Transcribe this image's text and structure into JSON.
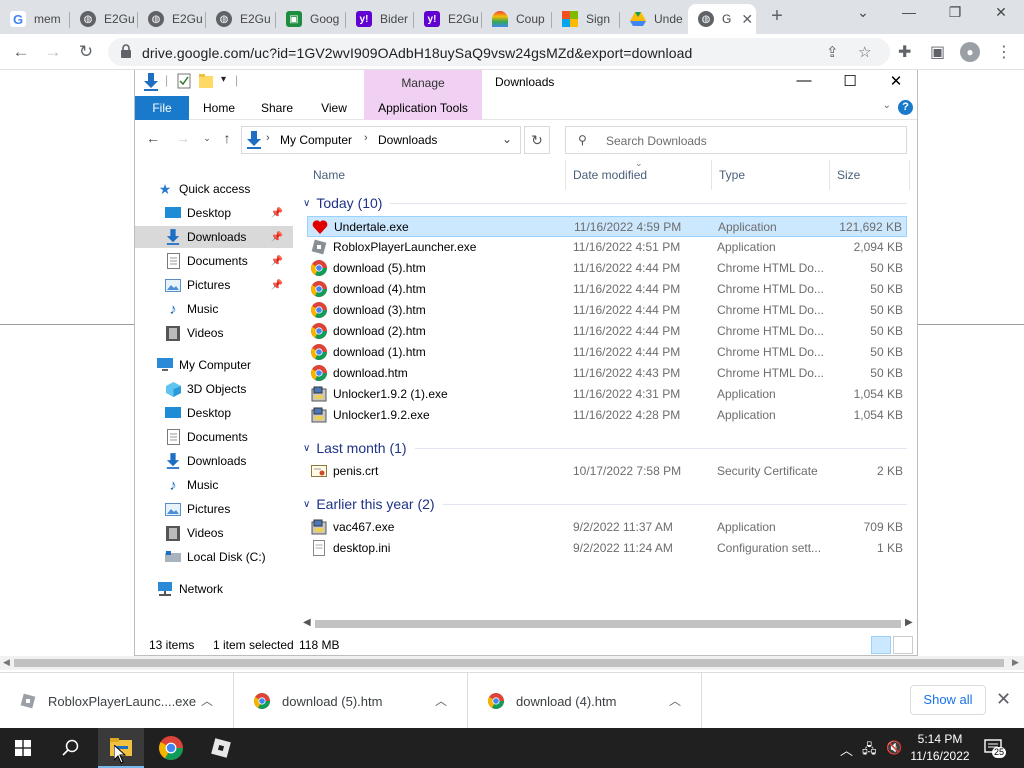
{
  "browser": {
    "tabs": [
      {
        "label": "mem",
        "icon": "google-icon",
        "color": "#4285f4"
      },
      {
        "label": "E2Gu",
        "icon": "globe-icon",
        "color": "#5f6368"
      },
      {
        "label": "E2Gu",
        "icon": "globe-icon",
        "color": "#5f6368"
      },
      {
        "label": "E2Gu",
        "icon": "globe-icon",
        "color": "#5f6368"
      },
      {
        "label": "Goog",
        "icon": "google-classroom-icon",
        "color": "#1e8e3e"
      },
      {
        "label": "Bider",
        "icon": "yahoo-icon",
        "color": "#6001d2"
      },
      {
        "label": "E2Gu",
        "icon": "yahoo-icon",
        "color": "#6001d2"
      },
      {
        "label": "Coup",
        "icon": "rainbow-icon",
        "color": "#ea4335"
      },
      {
        "label": "Sign",
        "icon": "microsoft-icon",
        "color": "#f25022"
      },
      {
        "label": "Unde",
        "icon": "google-drive-icon",
        "color": "#0f9d58"
      },
      {
        "label": "G",
        "icon": "globe-icon",
        "color": "#5f6368"
      }
    ],
    "url": "drive.google.com/uc?id=1GV2wvI909OAdbH18uySaQ9vsw24gsMZd&export=download"
  },
  "explorer": {
    "title": "Downloads",
    "manage_label": "Manage",
    "ribbon": {
      "file": "File",
      "home": "Home",
      "share": "Share",
      "view": "View",
      "app_tools": "Application Tools"
    },
    "breadcrumb": [
      "My Computer",
      "Downloads"
    ],
    "search_placeholder": "Search Downloads",
    "nav": {
      "quick_access": "Quick access",
      "quick_items": [
        "Desktop",
        "Downloads",
        "Documents",
        "Pictures",
        "Music",
        "Videos"
      ],
      "my_computer": "My Computer",
      "computer_items": [
        "3D Objects",
        "Desktop",
        "Documents",
        "Downloads",
        "Music",
        "Pictures",
        "Videos",
        "Local Disk (C:)"
      ],
      "network": "Network"
    },
    "columns": {
      "name": "Name",
      "date": "Date modified",
      "type": "Type",
      "size": "Size"
    },
    "groups": [
      {
        "label": "Today (10)",
        "files": [
          {
            "name": "Undertale.exe",
            "date": "11/16/2022 4:59 PM",
            "type": "Application",
            "size": "121,692 KB",
            "icon": "heart-icon",
            "selected": true
          },
          {
            "name": "RobloxPlayerLauncher.exe",
            "date": "11/16/2022 4:51 PM",
            "type": "Application",
            "size": "2,094 KB",
            "icon": "roblox-icon"
          },
          {
            "name": "download (5).htm",
            "date": "11/16/2022 4:44 PM",
            "type": "Chrome HTML Do...",
            "size": "50 KB",
            "icon": "chrome-icon"
          },
          {
            "name": "download (4).htm",
            "date": "11/16/2022 4:44 PM",
            "type": "Chrome HTML Do...",
            "size": "50 KB",
            "icon": "chrome-icon"
          },
          {
            "name": "download (3).htm",
            "date": "11/16/2022 4:44 PM",
            "type": "Chrome HTML Do...",
            "size": "50 KB",
            "icon": "chrome-icon"
          },
          {
            "name": "download (2).htm",
            "date": "11/16/2022 4:44 PM",
            "type": "Chrome HTML Do...",
            "size": "50 KB",
            "icon": "chrome-icon"
          },
          {
            "name": "download (1).htm",
            "date": "11/16/2022 4:44 PM",
            "type": "Chrome HTML Do...",
            "size": "50 KB",
            "icon": "chrome-icon"
          },
          {
            "name": "download.htm",
            "date": "11/16/2022 4:43 PM",
            "type": "Chrome HTML Do...",
            "size": "50 KB",
            "icon": "chrome-icon"
          },
          {
            "name": "Unlocker1.9.2 (1).exe",
            "date": "11/16/2022 4:31 PM",
            "type": "Application",
            "size": "1,054 KB",
            "icon": "installer-icon"
          },
          {
            "name": "Unlocker1.9.2.exe",
            "date": "11/16/2022 4:28 PM",
            "type": "Application",
            "size": "1,054 KB",
            "icon": "installer-icon"
          }
        ]
      },
      {
        "label": "Last month (1)",
        "files": [
          {
            "name": "penis.crt",
            "date": "10/17/2022 7:58 PM",
            "type": "Security Certificate",
            "size": "2 KB",
            "icon": "certificate-icon"
          }
        ]
      },
      {
        "label": "Earlier this year (2)",
        "files": [
          {
            "name": "vac467.exe",
            "date": "9/2/2022 11:37 AM",
            "type": "Application",
            "size": "709 KB",
            "icon": "installer-icon"
          },
          {
            "name": "desktop.ini",
            "date": "9/2/2022 11:24 AM",
            "type": "Configuration sett...",
            "size": "1 KB",
            "icon": "settings-file-icon"
          }
        ]
      }
    ],
    "status": {
      "items": "13 items",
      "selected": "1 item selected",
      "size": "118 MB"
    }
  },
  "downloads_shelf": {
    "items": [
      {
        "name": "RobloxPlayerLaunc....exe",
        "icon": "roblox-icon"
      },
      {
        "name": "download (5).htm",
        "icon": "chrome-icon"
      },
      {
        "name": "download (4).htm",
        "icon": "chrome-icon"
      }
    ],
    "show_all": "Show all"
  },
  "taskbar": {
    "time": "5:14 PM",
    "date": "11/16/2022",
    "notification_count": "25"
  }
}
